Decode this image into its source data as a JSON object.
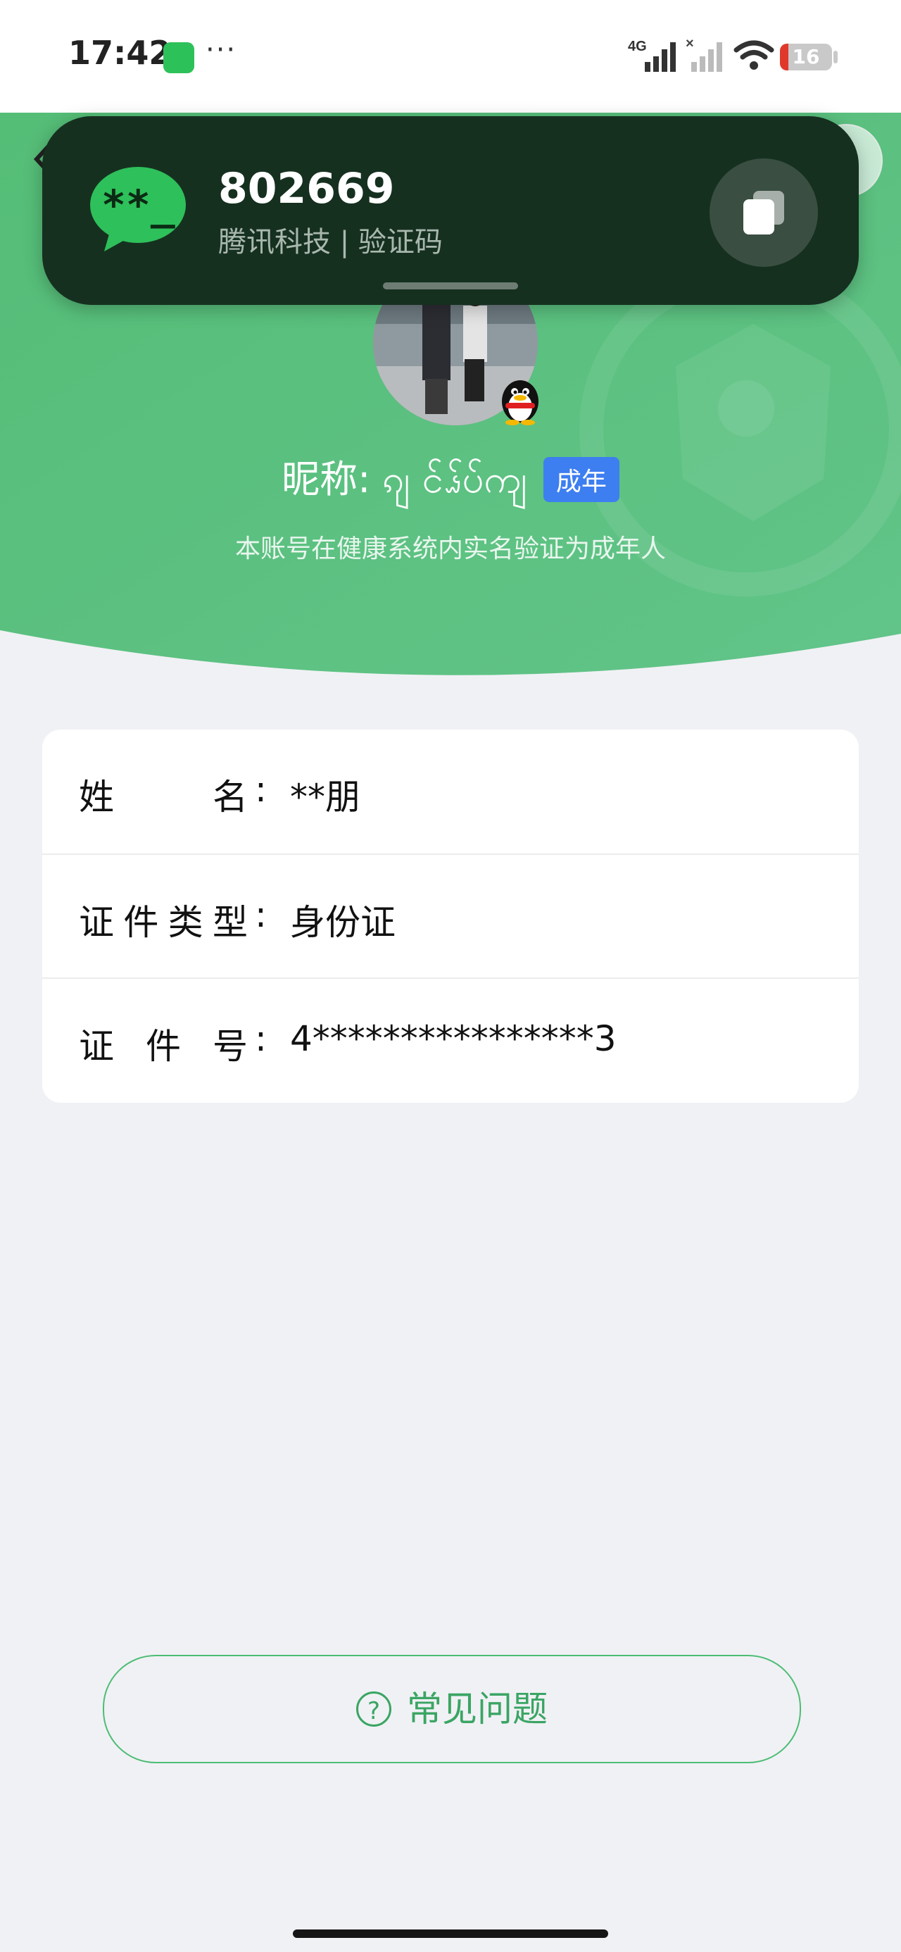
{
  "status_bar": {
    "time": "17:42",
    "network": "4G",
    "battery": "16",
    "battery_level": 0.16,
    "icons": [
      "wechat-icon",
      "more-dots-icon",
      "signal-4g-icon",
      "signal-no-service-icon",
      "wifi-icon",
      "battery-icon"
    ]
  },
  "notification": {
    "code": "802669",
    "subtitle": "腾讯科技 | 验证码",
    "app_icon": "otp-message-icon",
    "action_icon": "copy-icon"
  },
  "profile": {
    "nickname": "昵称: ၵျ ၚ်ၗ်ပ်ကျ",
    "age_badge": "成年",
    "verify_note": "本账号在健康系统内实名验证为成年人",
    "avatar_icon": "avatar-photo",
    "badge_icon": "qq-penguin-icon"
  },
  "info": {
    "rows": [
      {
        "label": "姓名",
        "value": "**朋"
      },
      {
        "label": "证件类型",
        "value": "身份证"
      },
      {
        "label": "证件号",
        "value": "4****************3"
      }
    ]
  },
  "faq": {
    "label": "常见问题",
    "icon": "question-circle-icon"
  },
  "colors": {
    "header_green": "#5cc27e",
    "page_bg": "#f0f1f5",
    "badge_blue": "#3d7ef0",
    "notification_bg": "#163020",
    "accent_green": "#3aa563"
  }
}
